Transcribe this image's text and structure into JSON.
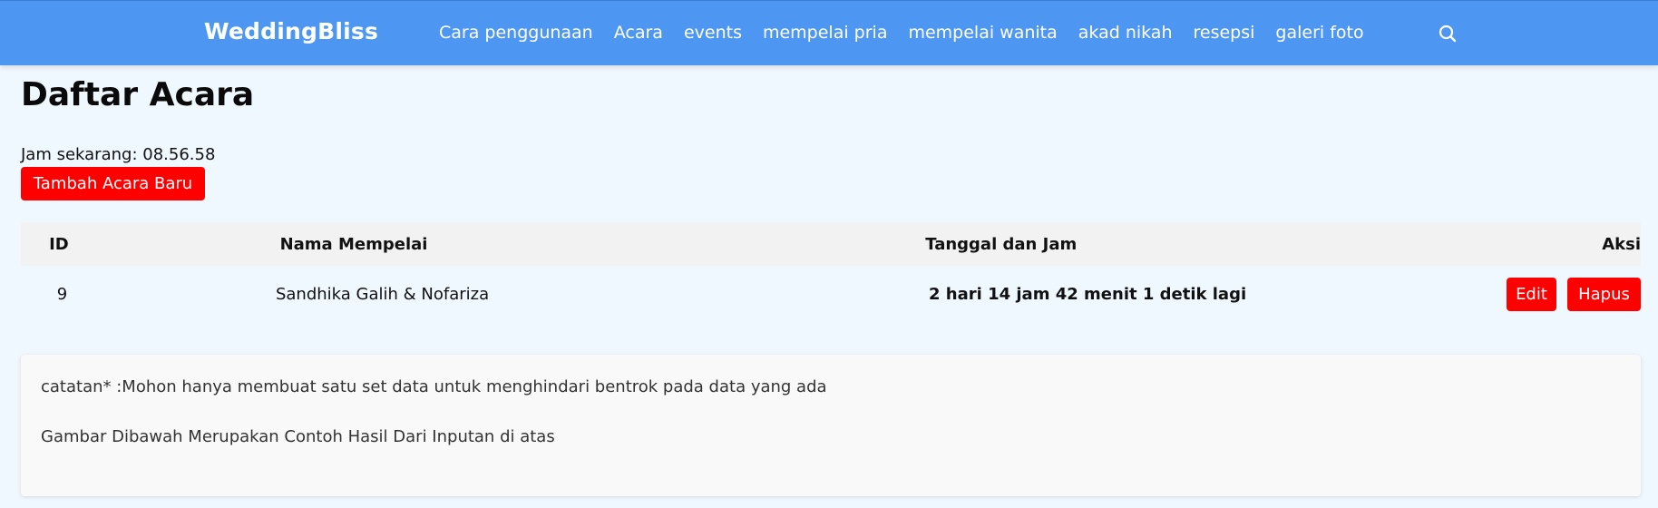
{
  "navbar": {
    "brand": "WeddingBliss",
    "links": [
      "Cara penggunaan",
      "Acara",
      "events",
      "mempelai pria",
      "mempelai wanita",
      "akad nikah",
      "resepsi",
      "galeri foto"
    ],
    "search_icon": "search-icon",
    "bg_color": "#4d97f3"
  },
  "page": {
    "title": "Daftar Acara",
    "clock_text": "Jam sekarang: 08.56.58",
    "add_button": "Tambah Acara Baru"
  },
  "table": {
    "headers": [
      "ID",
      "Nama Mempelai",
      "Tanggal dan Jam",
      "Aksi"
    ],
    "rows": [
      {
        "id": "9",
        "name": "Sandhika Galih & Nofariza",
        "countdown": "2 hari 14 jam 42 menit 1 detik lagi",
        "edit": "Edit",
        "delete": "Hapus"
      }
    ]
  },
  "note": {
    "line1": "catatan* :Mohon hanya membuat satu set data untuk menghindari bentrok pada data yang ada",
    "line2": "Gambar Dibawah Merupakan Contoh Hasil Dari Inputan di atas"
  },
  "colors": {
    "accent_red": "#ff0000",
    "page_bg": "#eff8fe"
  }
}
